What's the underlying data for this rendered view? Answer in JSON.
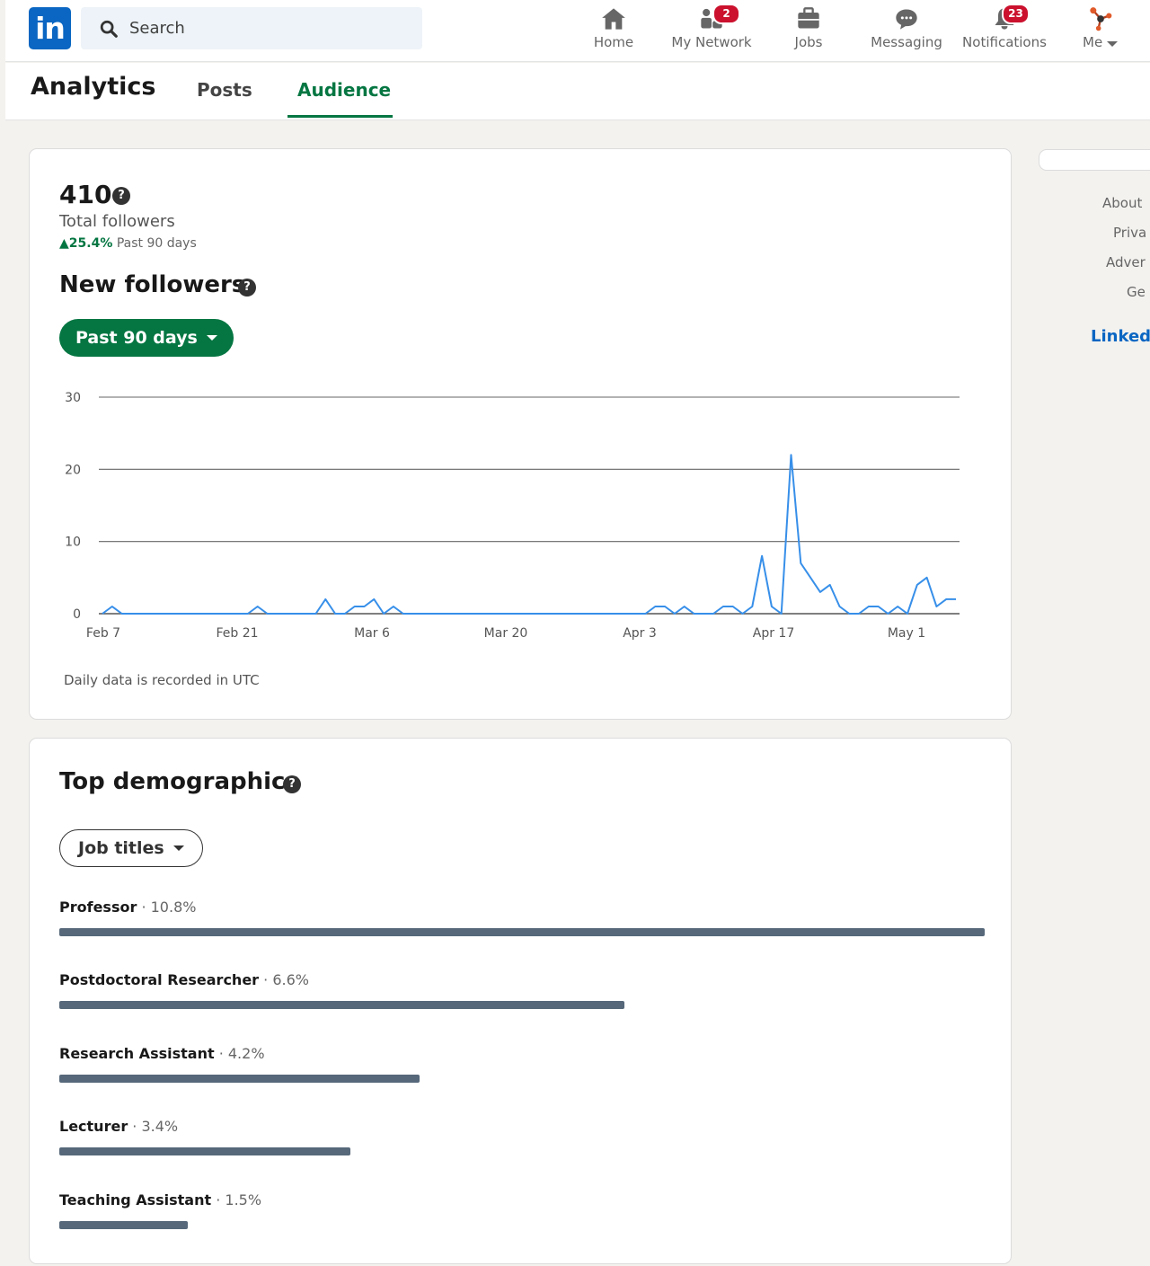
{
  "nav": {
    "logo": "in",
    "search_placeholder": "Search",
    "items": [
      {
        "label": "Home",
        "icon": "home-icon"
      },
      {
        "label": "My Network",
        "icon": "network-icon",
        "badge": "2"
      },
      {
        "label": "Jobs",
        "icon": "briefcase-icon"
      },
      {
        "label": "Messaging",
        "icon": "messaging-icon"
      },
      {
        "label": "Notifications",
        "icon": "bell-icon",
        "badge": "23"
      },
      {
        "label": "Me",
        "icon": "avatar"
      }
    ]
  },
  "subnav": {
    "title": "Analytics",
    "tabs": [
      "Posts",
      "Audience"
    ],
    "active_tab": "Audience"
  },
  "followers": {
    "total": "410",
    "total_label": "Total followers",
    "growth_pct": "25.4%",
    "growth_period": "Past 90 days",
    "section_title": "New followers",
    "range_button": "Past 90 days",
    "note": "Daily data is recorded in UTC"
  },
  "chart_data": {
    "type": "line",
    "title": "",
    "xlabel": "",
    "ylabel": "",
    "ylim": [
      0,
      30
    ],
    "yticks": [
      0,
      10,
      20,
      30
    ],
    "xticks": [
      "Feb 7",
      "Feb 21",
      "Mar 6",
      "Mar 20",
      "Apr 3",
      "Apr 17",
      "May 1"
    ],
    "grid": true,
    "series": [
      {
        "color": "#378fe9",
        "values": [
          0,
          1,
          0,
          0,
          0,
          0,
          0,
          0,
          0,
          0,
          0,
          0,
          0,
          0,
          0,
          0,
          1,
          0,
          0,
          0,
          0,
          0,
          0,
          2,
          0,
          0,
          1,
          1,
          2,
          0,
          1,
          0,
          0,
          0,
          0,
          0,
          0,
          0,
          0,
          0,
          0,
          0,
          0,
          0,
          0,
          0,
          0,
          0,
          0,
          0,
          0,
          0,
          0,
          0,
          0,
          0,
          0,
          1,
          1,
          0,
          1,
          0,
          0,
          0,
          1,
          1,
          0,
          1,
          8,
          1,
          0,
          22,
          7,
          5,
          3,
          4,
          1,
          0,
          0,
          1,
          1,
          0,
          1,
          0,
          4,
          5,
          1,
          2,
          2
        ]
      }
    ]
  },
  "demographics": {
    "section_title": "Top demographics",
    "filter": "Job titles",
    "rows": [
      {
        "title": "Professor",
        "pct": "10.8%",
        "value": 10.8
      },
      {
        "title": "Postdoctoral Researcher",
        "pct": "6.6%",
        "value": 6.6
      },
      {
        "title": "Research Assistant",
        "pct": "4.2%",
        "value": 4.2
      },
      {
        "title": "Lecturer",
        "pct": "3.4%",
        "value": 3.4
      },
      {
        "title": "Teaching Assistant",
        "pct": "1.5%",
        "value": 1.5
      }
    ]
  },
  "rail": {
    "links": [
      "About",
      "Priva",
      "Adver",
      "Ge"
    ],
    "brand": "Linked"
  },
  "colors": {
    "accent_green": "#057642",
    "brand_blue": "#0a66c2",
    "line_blue": "#378fe9",
    "bar_slate": "#56687a",
    "badge_red": "#cb112d"
  }
}
